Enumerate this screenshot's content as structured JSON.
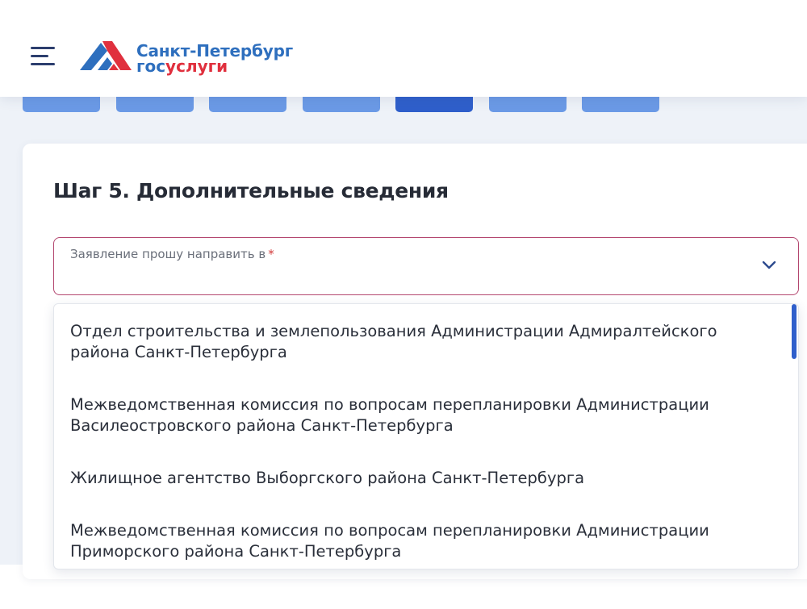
{
  "header": {
    "logo_city": "Санкт-Петербург",
    "logo_gos_part1": "гос",
    "logo_gos_part2": "услуги",
    "icons": {
      "menu": "hamburger-menu-icon",
      "logo": "gosuslugi-logo-icon"
    },
    "brand_colors": {
      "blue": "#2e6fbe",
      "red": "#e0303e"
    }
  },
  "steps": {
    "count": 7,
    "active_index": 4,
    "active_color": "#2f5fcb",
    "inactive_color": "#6b9ae6"
  },
  "form": {
    "step_title": "Шаг 5. Дополнительные сведения",
    "select": {
      "label": "Заявление прошу направить в",
      "required_mark": "*",
      "value": "",
      "icon": "chevron-down-icon",
      "border_color": "#b3466f"
    },
    "options": [
      "Отдел строительства и землепользования Администрации Адмиралтейского района Санкт-Петербурга",
      "Межведомственная комиссия по вопросам перепланировки Администрации Василеостровского района Санкт-Петербурга",
      "Жилищное агентство Выборгского района Санкт-Петербурга",
      "Межведомственная комиссия по вопросам перепланировки Администрации Приморского района Санкт-Петербурга"
    ]
  }
}
